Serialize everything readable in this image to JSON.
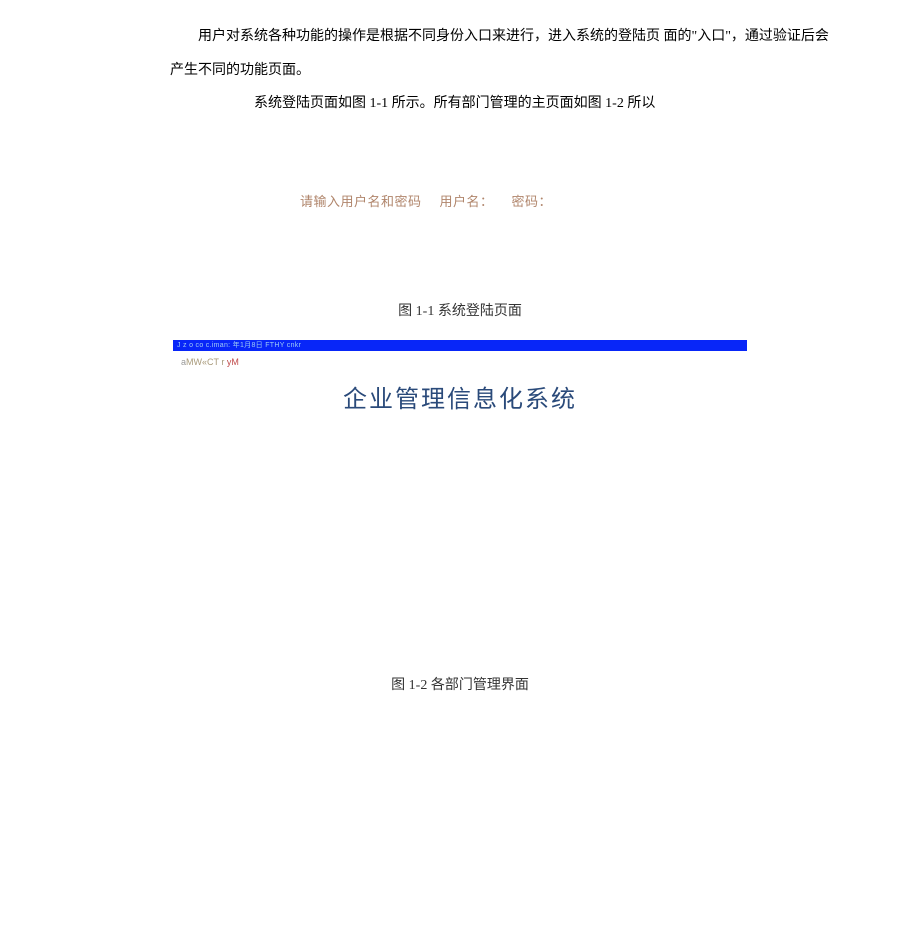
{
  "paragraph1": "用户对系统各种功能的操作是根据不同身份入口来进行，进入系统的登陆页 面的\"入口\"，通过验证后会产生不同的功能页面。",
  "paragraph2": "系统登陆页面如图 1-1 所示。所有部门管理的主页面如图 1-2 所以",
  "login": {
    "prompt": "请输入用户名和密码",
    "username_label": "用户名：",
    "password_label": "密码：",
    "full": "请输入用户名和密码  用户名：   密码："
  },
  "captions": {
    "fig1_1": "图 1-1 系统登陆页面",
    "fig1_2": "图 1-2 各部门管理界面"
  },
  "figure2": {
    "bar_text": "J z o co c.iman: 年1月8日 FTHY cnkr",
    "sub_text_prefix": "a",
    "sub_text_mid": "MW«CT r ",
    "sub_text_accent": "yM",
    "title": "企业管理信息化系统"
  }
}
